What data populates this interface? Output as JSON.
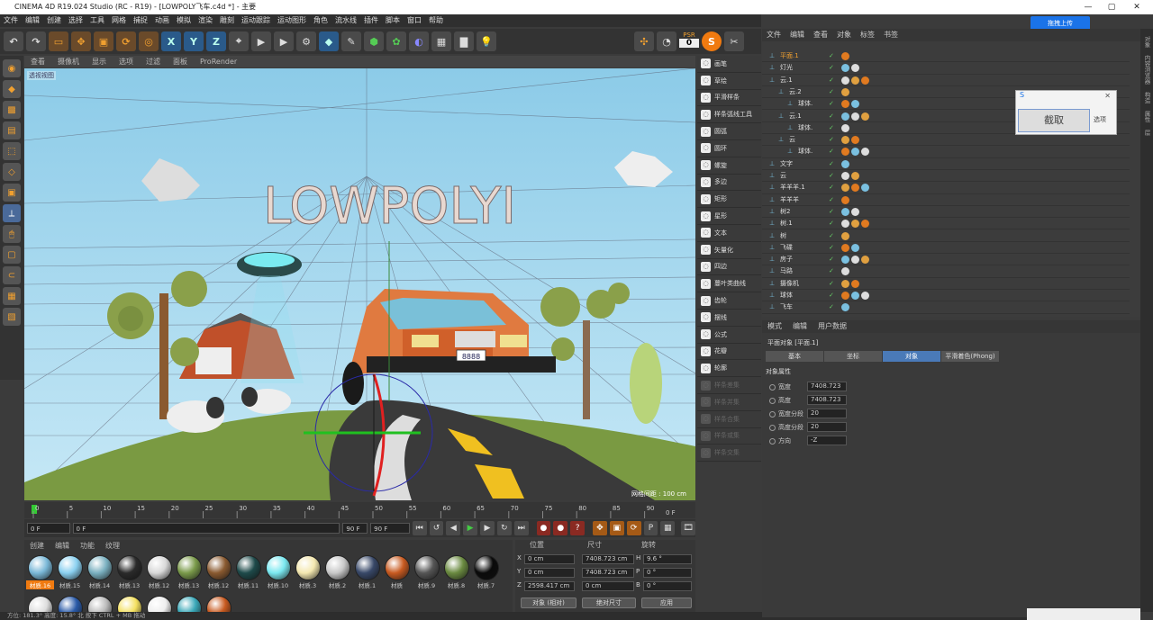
{
  "window": {
    "title": "CINEMA 4D R19.024 Studio (RC - R19) - [LOWPOLY飞车.c4d *] - 主要",
    "upload": "拖拽上传"
  },
  "menu": [
    "文件",
    "编辑",
    "创建",
    "选择",
    "工具",
    "网格",
    "捕捉",
    "动画",
    "模拟",
    "渲染",
    "雕刻",
    "运动跟踪",
    "运动图形",
    "角色",
    "流水线",
    "插件",
    "脚本",
    "窗口",
    "帮助"
  ],
  "toolbar": {
    "axes": [
      "X",
      "Y",
      "Z"
    ],
    "psr": "PSR",
    "psr_value": "0"
  },
  "viewport": {
    "menu": [
      "查看",
      "摄像机",
      "显示",
      "选项",
      "过滤",
      "面板",
      "ProRender"
    ],
    "label": "透视视图",
    "title_text": "LOWPOLYI",
    "plate": "8888",
    "grid": "网格间距 : 100 cm"
  },
  "objects": [
    {
      "label": "画笔",
      "dim": false
    },
    {
      "label": "草绘",
      "dim": false
    },
    {
      "label": "平滑样条",
      "dim": false
    },
    {
      "label": "样条弧线工具",
      "dim": false
    },
    {
      "label": "圆弧",
      "dim": false
    },
    {
      "label": "圆环",
      "dim": false
    },
    {
      "label": "螺旋",
      "dim": false
    },
    {
      "label": "多边",
      "dim": false
    },
    {
      "label": "矩形",
      "dim": false
    },
    {
      "label": "星形",
      "dim": false
    },
    {
      "label": "文本",
      "dim": false
    },
    {
      "label": "矢量化",
      "dim": false
    },
    {
      "label": "四边",
      "dim": false
    },
    {
      "label": "蔓叶类曲线",
      "dim": false
    },
    {
      "label": "齿轮",
      "dim": false
    },
    {
      "label": "摆线",
      "dim": false
    },
    {
      "label": "公式",
      "dim": false
    },
    {
      "label": "花瓣",
      "dim": false
    },
    {
      "label": "轮廓",
      "dim": false
    },
    {
      "label": "样条差集",
      "dim": true
    },
    {
      "label": "样条并集",
      "dim": true
    },
    {
      "label": "样条合集",
      "dim": true
    },
    {
      "label": "样条或集",
      "dim": true
    },
    {
      "label": "样条交集",
      "dim": true
    }
  ],
  "timeline": {
    "ticks": [
      "0",
      "5",
      "10",
      "15",
      "20",
      "25",
      "30",
      "35",
      "40",
      "45",
      "50",
      "55",
      "60",
      "65",
      "70",
      "75",
      "80",
      "85",
      "90"
    ],
    "end": "0 F",
    "start_field": "0 F",
    "cur_field": "0 F",
    "max_field": "90 F",
    "max_field2": "90 F"
  },
  "materials": {
    "menu": [
      "创建",
      "编辑",
      "功能",
      "纹理"
    ],
    "row1": [
      {
        "name": "材质.16",
        "color": "#7ab8d8"
      },
      {
        "name": "材质.15",
        "color": "#8ad0f0"
      },
      {
        "name": "材质.14",
        "color": "#7ab0c0"
      },
      {
        "name": "材质.13",
        "color": "#2a2a2a"
      },
      {
        "name": "材质.12",
        "color": "#d8d8d8"
      },
      {
        "name": "材质.13",
        "color": "#7a9a4a"
      },
      {
        "name": "材质.12",
        "color": "#8a5a30"
      },
      {
        "name": "材质.11",
        "color": "#1e4a4a"
      },
      {
        "name": "材质.10",
        "color": "#7ae8f0"
      },
      {
        "name": "材质.3",
        "color": "#f4e8b0"
      },
      {
        "name": "材质.2",
        "color": "#c8c8c8"
      },
      {
        "name": "材质.1",
        "color": "#384868"
      },
      {
        "name": "材质",
        "color": "#c85a20"
      },
      {
        "name": "材质.9",
        "color": "#555555"
      },
      {
        "name": "材质.8",
        "color": "#6a8a40"
      },
      {
        "name": "材质.7",
        "color": "#0a0a0a"
      }
    ],
    "row2": [
      {
        "color": "#dddddd"
      },
      {
        "color": "#2a5aa8"
      },
      {
        "color": "#bbbbbb"
      },
      {
        "color": "#f4e060"
      },
      {
        "color": "#eeeeee"
      },
      {
        "color": "#3aa8b8"
      },
      {
        "color": "#c85a20"
      }
    ]
  },
  "coords": {
    "headers": [
      "位置",
      "尺寸",
      "旋转"
    ],
    "rows": [
      {
        "axis": "X",
        "pos": "0 cm",
        "size": "7408.723 cm",
        "rl": "H",
        "rot": "9.6 °"
      },
      {
        "axis": "Y",
        "pos": "0 cm",
        "size": "7408.723 cm",
        "rl": "P",
        "rot": "0 °"
      },
      {
        "axis": "Z",
        "pos": "2598.417 cm",
        "size": "0 cm",
        "rl": "B",
        "rot": "0 °"
      }
    ],
    "mode1": "对象 (相对)",
    "mode2": "绝对尺寸",
    "apply": "应用"
  },
  "status": "方位: 181.3° 高度: 15.8° 北   按下 CTRL + MB 拖动",
  "om": {
    "menu": [
      "文件",
      "编辑",
      "查看",
      "对象",
      "标签",
      "书签"
    ],
    "rows": [
      {
        "name": "平面.1",
        "ind": 0,
        "hl": true
      },
      {
        "name": "灯光",
        "ind": 0,
        "hl": false
      },
      {
        "name": "云.1",
        "ind": 0,
        "hl": false
      },
      {
        "name": "云.2",
        "ind": 1,
        "hl": false
      },
      {
        "name": "球体.",
        "ind": 2,
        "hl": false
      },
      {
        "name": "云.1",
        "ind": 1,
        "hl": false
      },
      {
        "name": "球体.",
        "ind": 2,
        "hl": false
      },
      {
        "name": "云",
        "ind": 1,
        "hl": false
      },
      {
        "name": "球体.",
        "ind": 2,
        "hl": false
      },
      {
        "name": "文字",
        "ind": 0,
        "hl": false
      },
      {
        "name": "云",
        "ind": 0,
        "hl": false
      },
      {
        "name": "羊羊羊.1",
        "ind": 0,
        "hl": false
      },
      {
        "name": "羊羊羊",
        "ind": 0,
        "hl": false
      },
      {
        "name": "树2",
        "ind": 0,
        "hl": false
      },
      {
        "name": "树.1",
        "ind": 0,
        "hl": false
      },
      {
        "name": "树",
        "ind": 0,
        "hl": false
      },
      {
        "name": "飞碟",
        "ind": 0,
        "hl": false
      },
      {
        "name": "房子",
        "ind": 0,
        "hl": false
      },
      {
        "name": "马路",
        "ind": 0,
        "hl": false
      },
      {
        "name": "摄像机",
        "ind": 0,
        "hl": false
      },
      {
        "name": "球体",
        "ind": 0,
        "hl": false
      },
      {
        "name": "飞车",
        "ind": 0,
        "hl": false
      }
    ]
  },
  "attr": {
    "menu": [
      "模式",
      "编辑",
      "用户数据"
    ],
    "title": "平面对象 [平面.1]",
    "tabs": [
      "基本",
      "坐标",
      "对象",
      "平滑着色(Phong)"
    ],
    "section": "对象属性",
    "fields": [
      {
        "label": "宽度",
        "value": "7408.723"
      },
      {
        "label": "高度",
        "value": "7408.723"
      },
      {
        "label": "宽度分段",
        "value": "20"
      },
      {
        "label": "高度分段",
        "value": "20"
      },
      {
        "label": "方向",
        "value": "-Z"
      }
    ]
  },
  "popup": {
    "capture": "截取",
    "options": "选项"
  },
  "side": [
    "对象",
    "内容浏览器",
    "构造",
    "属性",
    "层"
  ]
}
